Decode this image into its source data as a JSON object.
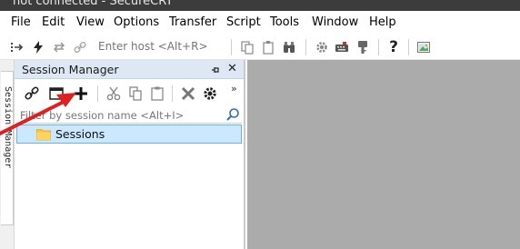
{
  "window": {
    "title": "not connected - SecureCRT"
  },
  "menu": [
    "File",
    "Edit",
    "View",
    "Options",
    "Transfer",
    "Script",
    "Tools",
    "Window",
    "Help"
  ],
  "toolbar": {
    "quick_connect_placeholder": "Enter host <Alt+R>"
  },
  "side_tab": {
    "label": "Session Manager"
  },
  "session_manager": {
    "title": "Session Manager",
    "filter_placeholder": "Filter by session name <Alt+I>",
    "tree": [
      {
        "label": "Sessions",
        "selected": true,
        "icon": "folder-icon"
      }
    ]
  },
  "colors": {
    "header_bg": "#dde8f5",
    "selection_bg": "#cce8ff",
    "workspace_bg": "#ababab",
    "annotation_arrow": "#e02020",
    "folder": "#f5c542"
  }
}
